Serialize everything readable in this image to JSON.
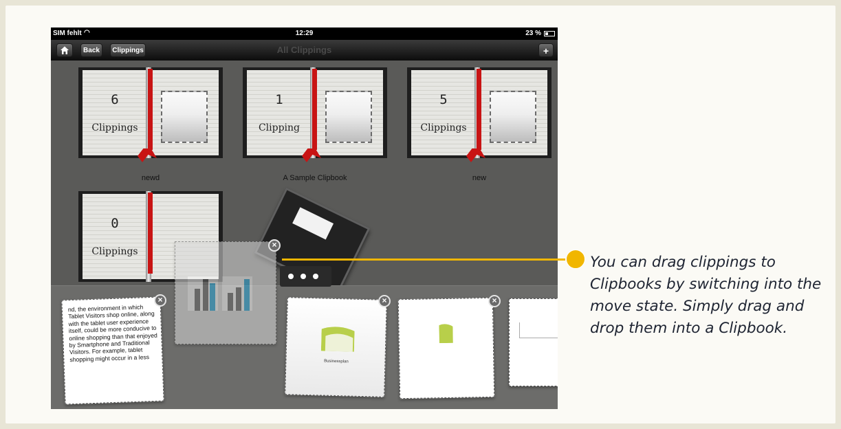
{
  "status_bar": {
    "carrier": "SIM fehlt",
    "time": "12:29",
    "battery": "23 %"
  },
  "nav": {
    "back_label": "Back",
    "clippings_label": "Clippings",
    "title": "All Clippings",
    "add_label": "+"
  },
  "clipbooks": [
    {
      "count": "6",
      "unit": "Clippings",
      "title": "newd"
    },
    {
      "count": "1",
      "unit": "Clipping",
      "title": "A Sample Clipbook"
    },
    {
      "count": "5",
      "unit": "Clippings",
      "title": "new"
    },
    {
      "count": "0",
      "unit": "Clippings",
      "title": ""
    }
  ],
  "clippings": [
    {
      "text": "nd, the environment in which Tablet Visitors shop online, along with the tablet user experience itself, could be more conducive to online shopping than that enjoyed by Smartphone and Traditional Visitors. For example, tablet shopping might occur in a less"
    },
    {
      "text": "Businessplan"
    }
  ],
  "close_glyph": "×",
  "callout": {
    "text": "You can drag clippings to Clipbooks by switching into the move state. Simply drag and drop them into a Clipbook.",
    "color": "#f1b600"
  }
}
